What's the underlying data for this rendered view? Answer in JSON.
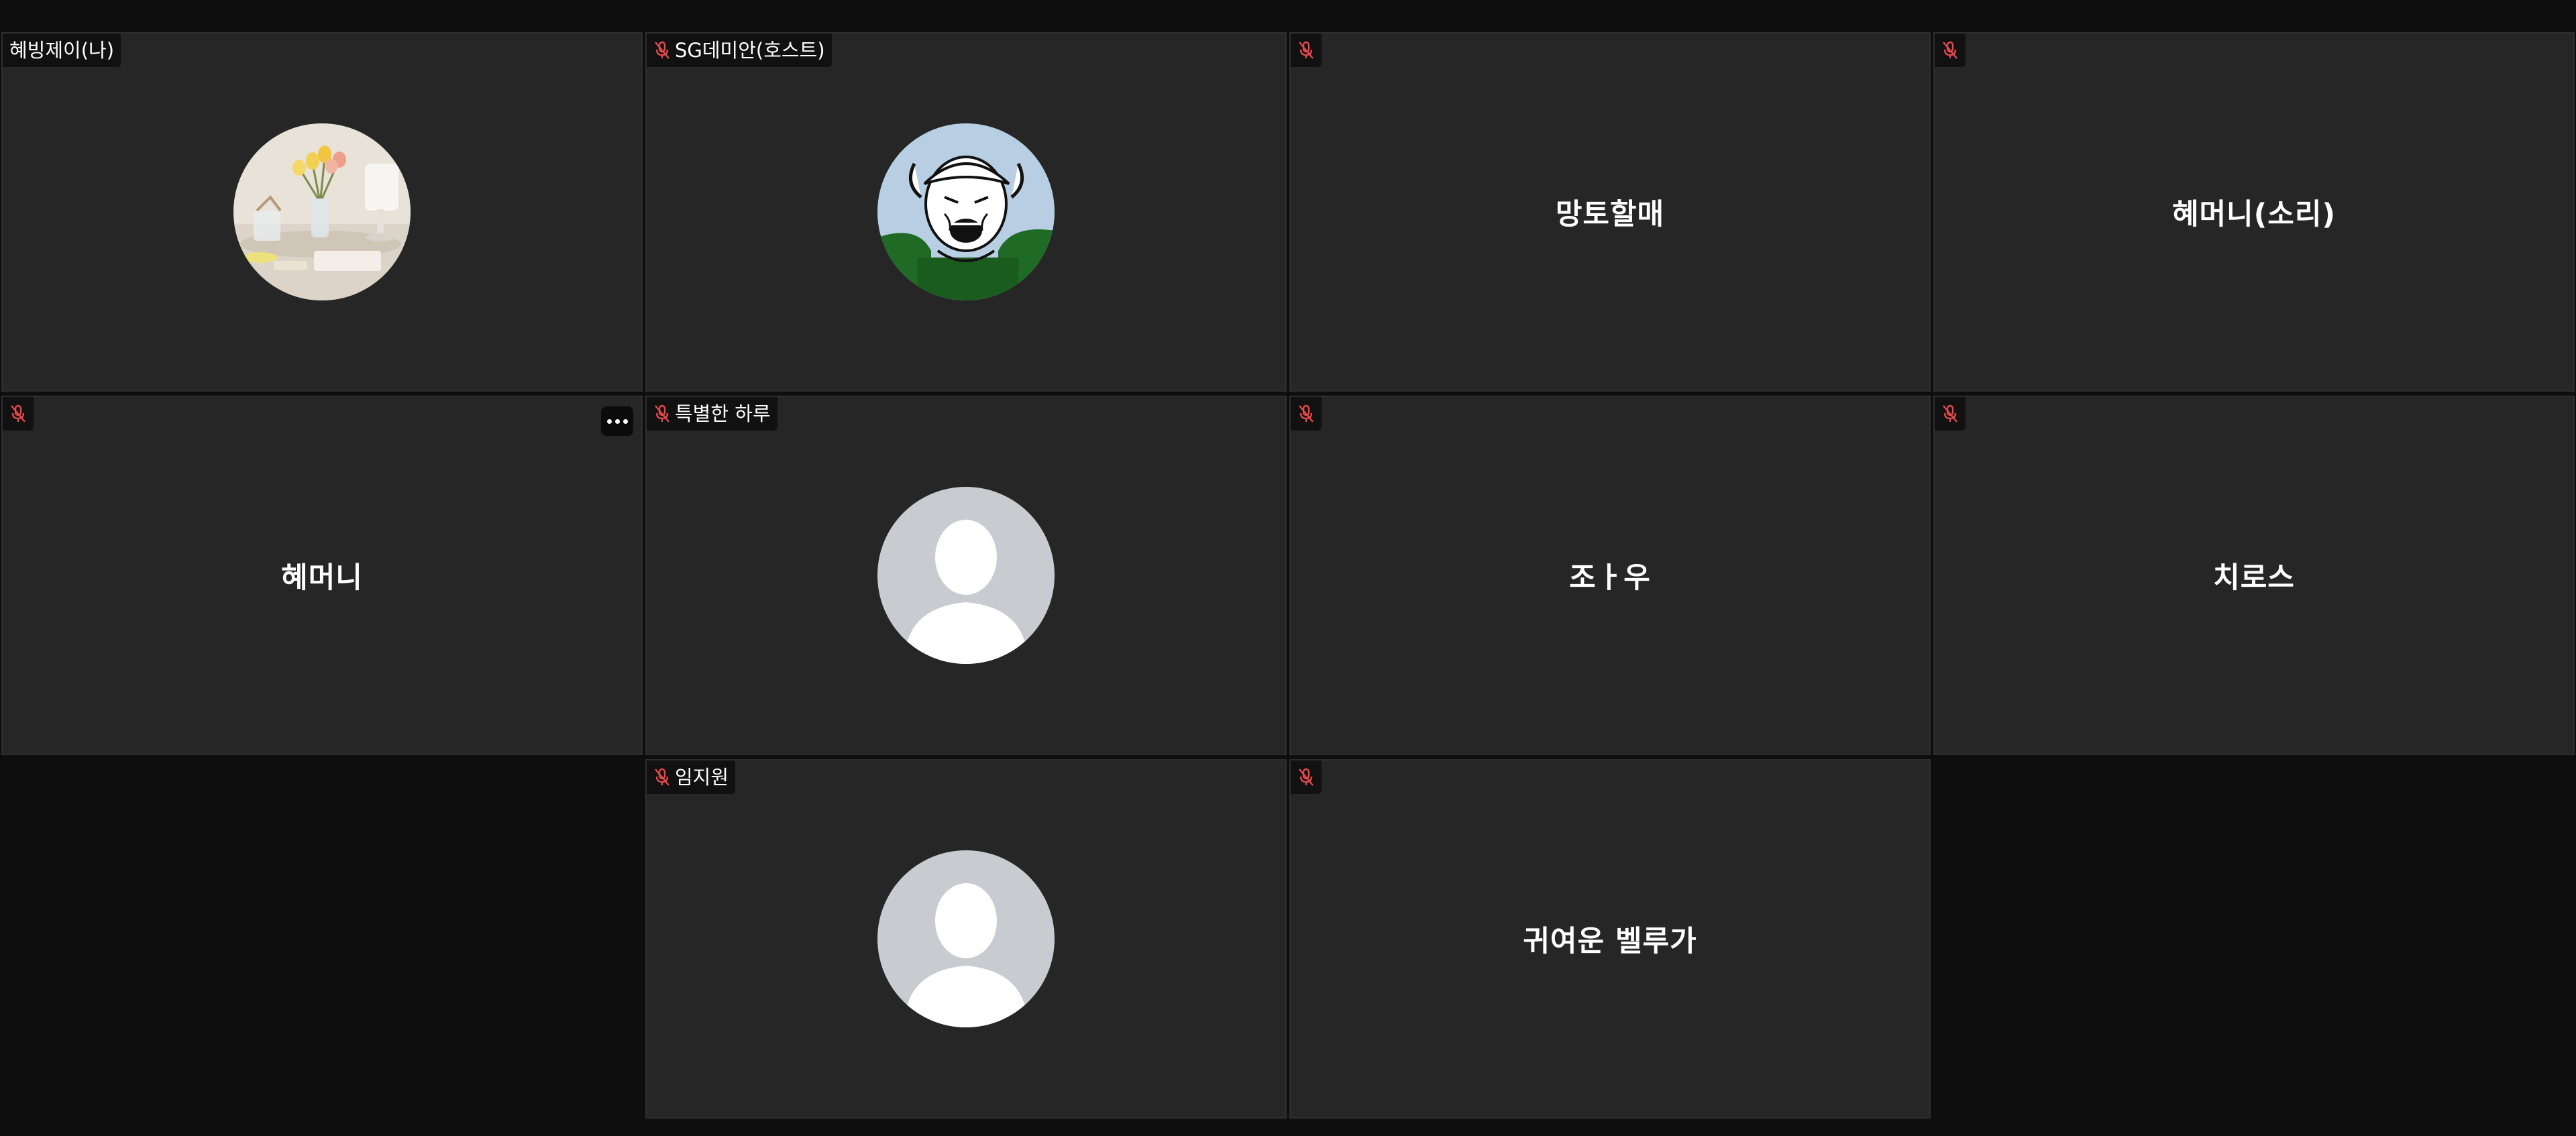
{
  "participants": [
    {
      "name": "혜빙제이(나)",
      "muted": false,
      "avatar": "photo-flowers-lamp",
      "show_label": true
    },
    {
      "name": "SG데미안(호스트)",
      "muted": true,
      "avatar": "cartoon-man-cap",
      "show_label": true
    },
    {
      "name": "망토할매",
      "muted": true,
      "avatar": null,
      "show_label": false
    },
    {
      "name": "혜머니(소리)",
      "muted": true,
      "avatar": null,
      "show_label": false
    },
    {
      "name": "혜머니",
      "muted": true,
      "avatar": null,
      "show_label": false,
      "more_menu": true
    },
    {
      "name": "특별한 하루",
      "muted": true,
      "avatar": "default-person",
      "show_label": true
    },
    {
      "name": "조ㅏ우",
      "muted": true,
      "avatar": null,
      "show_label": false
    },
    {
      "name": "치로스",
      "muted": true,
      "avatar": null,
      "show_label": false
    },
    {
      "name": "임지원",
      "muted": true,
      "avatar": "default-person",
      "show_label": true
    },
    {
      "name": "귀여운 벨루가",
      "muted": true,
      "avatar": null,
      "show_label": false
    }
  ],
  "colors": {
    "background": "#0e0e0e",
    "tile": "#262626",
    "label_bg": "#111111",
    "mic_muted": "#e5484d",
    "text": "#ffffff",
    "default_avatar_bg": "#c8cbd0"
  },
  "icons": {
    "muted": "mic-off-icon",
    "more": "more-options-icon"
  }
}
